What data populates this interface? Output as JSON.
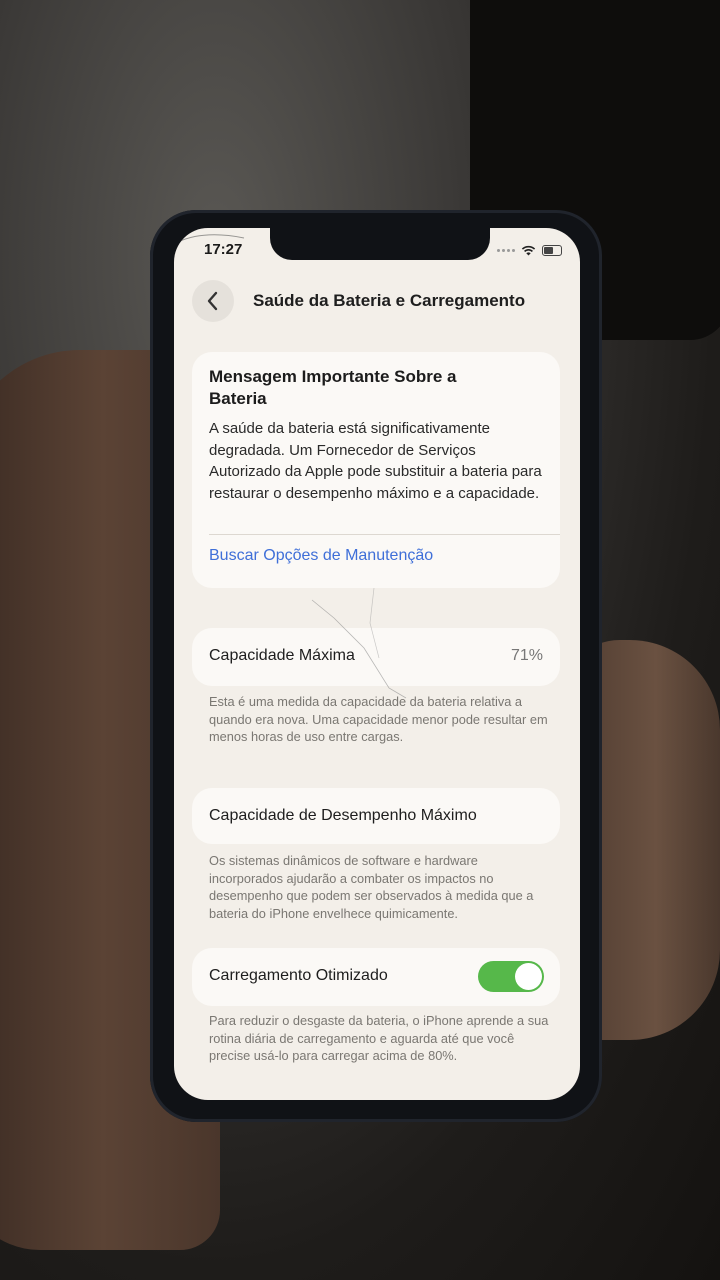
{
  "status_bar": {
    "time": "17:27"
  },
  "nav": {
    "title": "Saúde da Bateria e Carregamento",
    "back_icon": "chevron-left-icon"
  },
  "important_message": {
    "title": "Mensagem Importante Sobre a Bateria",
    "body": "A saúde da bateria está significativamente degradada. Um Fornecedor de Serviços Autorizado da Apple pode substituir a bateria para restaurar o desempenho máximo e a capacidade.",
    "link": "Buscar Opções de Manutenção"
  },
  "max_capacity": {
    "label": "Capacidade Máxima",
    "value": "71%",
    "footnote": "Esta é uma medida da capacidade da bateria relativa a quando era nova. Uma capacidade menor pode resultar em menos horas de uso entre cargas."
  },
  "peak_performance": {
    "label": "Capacidade de Desempenho Máximo",
    "footnote": "Os sistemas dinâmicos de software e hardware incorporados ajudarão a combater os impactos no desempenho que podem ser observados à medida que a bateria do iPhone envelhece quimicamente."
  },
  "optimized_charging": {
    "label": "Carregamento Otimizado",
    "enabled": true,
    "footnote": "Para reduzir o desgaste da bateria, o iPhone aprende a sua rotina diária de carregamento e aguarda até que você precise usá-lo para carregar acima de 80%."
  },
  "colors": {
    "link": "#3f6fd8",
    "toggle_on": "#56b84a",
    "screen_bg": "#f3efe9"
  }
}
